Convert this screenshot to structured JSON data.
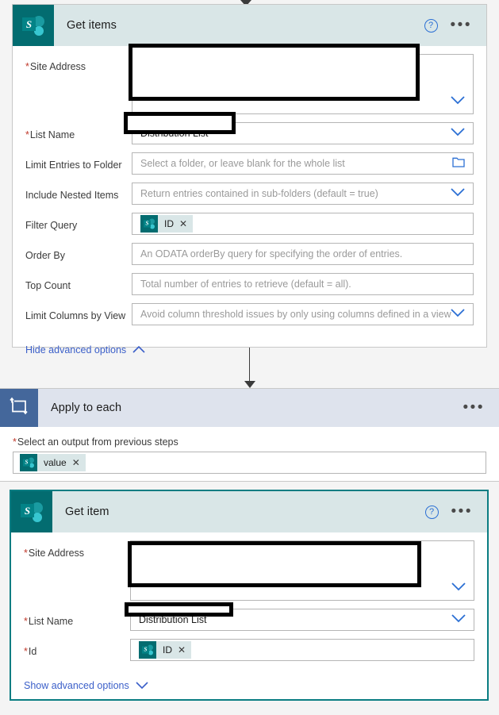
{
  "theme": {
    "page_bg": "#f4f4f4",
    "sharepoint_teal": "#036c70",
    "header_bg": "#d9e6e7",
    "loop_header_bg": "#dee3ed",
    "loop_icon_bg": "#44679b",
    "accent_blue": "#2b6fd4",
    "link_blue": "#3b5fc9",
    "required_red": "#c0392b",
    "selected_border": "#0a7d82"
  },
  "get_items_card": {
    "title": "Get items",
    "icon": "sharepoint-icon",
    "icon_letter": "S",
    "help_label": "?",
    "menu_label": "•••",
    "fields": [
      {
        "label": "Site Address",
        "required": true,
        "value": "",
        "placeholder": "",
        "control": "dropdown",
        "redacted": true,
        "tall": true
      },
      {
        "label": "List Name",
        "required": true,
        "value": "Distribution List",
        "placeholder": "",
        "control": "dropdown",
        "redacted": true,
        "tall": false
      },
      {
        "label": "Limit Entries to Folder",
        "required": false,
        "value": "",
        "placeholder": "Select a folder, or leave blank for the whole list",
        "control": "folder-picker",
        "redacted": false,
        "tall": false
      },
      {
        "label": "Include Nested Items",
        "required": false,
        "value": "",
        "placeholder": "Return entries contained in sub-folders (default = true)",
        "control": "dropdown",
        "redacted": false,
        "tall": false
      },
      {
        "label": "Filter Query",
        "required": false,
        "value": "",
        "placeholder": "",
        "control": "token",
        "token": "ID",
        "redacted": false,
        "tall": false
      },
      {
        "label": "Order By",
        "required": false,
        "value": "",
        "placeholder": "An ODATA orderBy query for specifying the order of entries.",
        "control": "text",
        "redacted": false,
        "tall": false
      },
      {
        "label": "Top Count",
        "required": false,
        "value": "",
        "placeholder": "Total number of entries to retrieve (default = all).",
        "control": "text",
        "redacted": false,
        "tall": false
      },
      {
        "label": "Limit Columns by View",
        "required": false,
        "value": "",
        "placeholder": "Avoid column threshold issues by only using columns defined in a view",
        "control": "dropdown",
        "redacted": false,
        "tall": false
      }
    ],
    "advanced_link": "Hide advanced options",
    "advanced_chevron": "chevron-up-icon"
  },
  "apply_to_each_card": {
    "title": "Apply to each",
    "icon": "loop-icon",
    "menu_label": "•••",
    "output_label": "Select an output from previous steps",
    "output_required": true,
    "output_token": "value"
  },
  "get_item_card": {
    "title": "Get item",
    "icon": "sharepoint-icon",
    "icon_letter": "S",
    "help_label": "?",
    "menu_label": "•••",
    "selected": true,
    "fields": [
      {
        "label": "Site Address",
        "required": true,
        "value": "",
        "placeholder": "",
        "control": "dropdown",
        "redacted": true,
        "tall": true
      },
      {
        "label": "List Name",
        "required": true,
        "value": "Distribution List",
        "placeholder": "",
        "control": "dropdown",
        "redacted": true,
        "tall": false
      },
      {
        "label": "Id",
        "required": true,
        "value": "",
        "placeholder": "",
        "control": "token",
        "token": "ID",
        "redacted": false,
        "tall": false
      }
    ],
    "advanced_link": "Show advanced options",
    "advanced_chevron": "chevron-down-icon"
  }
}
